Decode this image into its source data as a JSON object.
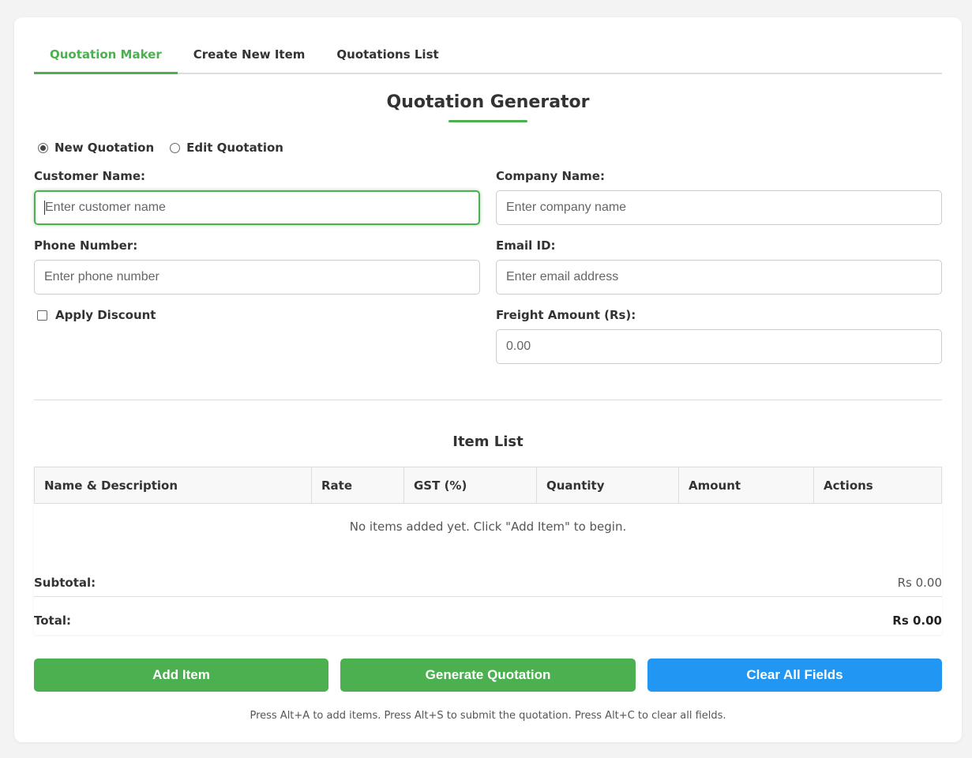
{
  "tabs": [
    {
      "label": "Quotation Maker",
      "active": true
    },
    {
      "label": "Create New Item",
      "active": false
    },
    {
      "label": "Quotations List",
      "active": false
    }
  ],
  "page_title": "Quotation Generator",
  "mode": {
    "new_label": "New Quotation",
    "edit_label": "Edit Quotation",
    "selected": "new"
  },
  "form": {
    "customer_name": {
      "label": "Customer Name:",
      "placeholder": "Enter customer name",
      "value": ""
    },
    "company_name": {
      "label": "Company Name:",
      "placeholder": "Enter company name",
      "value": ""
    },
    "phone": {
      "label": "Phone Number:",
      "placeholder": "Enter phone number",
      "value": ""
    },
    "email": {
      "label": "Email ID:",
      "placeholder": "Enter email address",
      "value": ""
    },
    "apply_discount": {
      "label": "Apply Discount",
      "checked": false
    },
    "freight": {
      "label": "Freight Amount (Rs):",
      "placeholder": "0.00",
      "value": ""
    }
  },
  "item_list": {
    "title": "Item List",
    "columns": [
      "Name & Description",
      "Rate",
      "GST (%)",
      "Quantity",
      "Amount",
      "Actions"
    ],
    "empty_message": "No items added yet. Click \"Add Item\" to begin.",
    "subtotal_label": "Subtotal:",
    "subtotal_value": "Rs 0.00",
    "total_label": "Total:",
    "total_value": "Rs 0.00"
  },
  "buttons": {
    "add_item": "Add Item",
    "generate": "Generate Quotation",
    "clear": "Clear All Fields"
  },
  "hint": "Press Alt+A to add items. Press Alt+S to submit the quotation. Press Alt+C to clear all fields.",
  "colors": {
    "accent_green": "#4caf50",
    "accent_blue": "#2196f3"
  }
}
